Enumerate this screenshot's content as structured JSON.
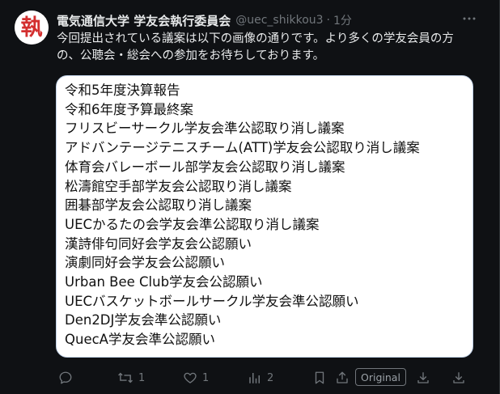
{
  "post": {
    "display_name": "電気通信大学 学友会執行委員会",
    "handle": "@uec_shikkou3",
    "separator": "·",
    "time": "1分",
    "avatar_char": "執",
    "text_line1": "今回提出されている議案は以下の画像の通りです。より多くの学友会員の方",
    "text_line2": "の、公聴会・総会への参加をお待ちしております。"
  },
  "image": {
    "agenda_items": [
      "令和5年度決算報告",
      "令和6年度予算最終案",
      "フリスビーサークル学友会準公認取り消し議案",
      "アドバンテージテニスチーム(ATT)学友会公認取り消し議案",
      "体育会バレーボール部学友会公認取り消し議案",
      "松濤館空手部学友会公認取り消し議案",
      "囲碁部学友会公認取り消し議案",
      "UECかるたの会学友会準公認取り消し議案",
      "漢詩俳句同好会学友会公認願い",
      "演劇同好会学友会公認願い",
      "Urban Bee Club学友会公認願い",
      "UECバスケットボールサークル学友会準公認願い",
      "Den2DJ学友会準公認願い",
      "QuecA学友会準公認願い"
    ]
  },
  "actions": {
    "reply_count": "",
    "retweet_count": "1",
    "like_count": "1",
    "views_count": "2",
    "original_label": "Original"
  },
  "colors": {
    "background": "#0f1114",
    "text": "#e7e9ea",
    "muted": "#71767b",
    "avatar_accent": "#d32f2f",
    "image_border": "#bfd0e6"
  }
}
